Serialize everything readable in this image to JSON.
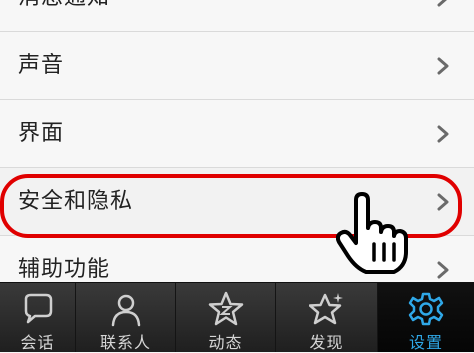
{
  "settings": {
    "items": [
      {
        "label": "消息通知"
      },
      {
        "label": "声音"
      },
      {
        "label": "界面"
      },
      {
        "label": "安全和隐私"
      },
      {
        "label": "辅助功能"
      }
    ]
  },
  "tabbar": {
    "tabs": [
      {
        "label": "会话",
        "icon": "chat-bubble-icon"
      },
      {
        "label": "联系人",
        "icon": "person-icon"
      },
      {
        "label": "动态",
        "icon": "star-z-icon"
      },
      {
        "label": "发现",
        "icon": "star-sparkle-icon"
      },
      {
        "label": "设置",
        "icon": "gear-icon"
      }
    ],
    "active_index": 4
  },
  "colors": {
    "highlight_ring": "#e00000",
    "active_tab": "#2fa8e8"
  }
}
